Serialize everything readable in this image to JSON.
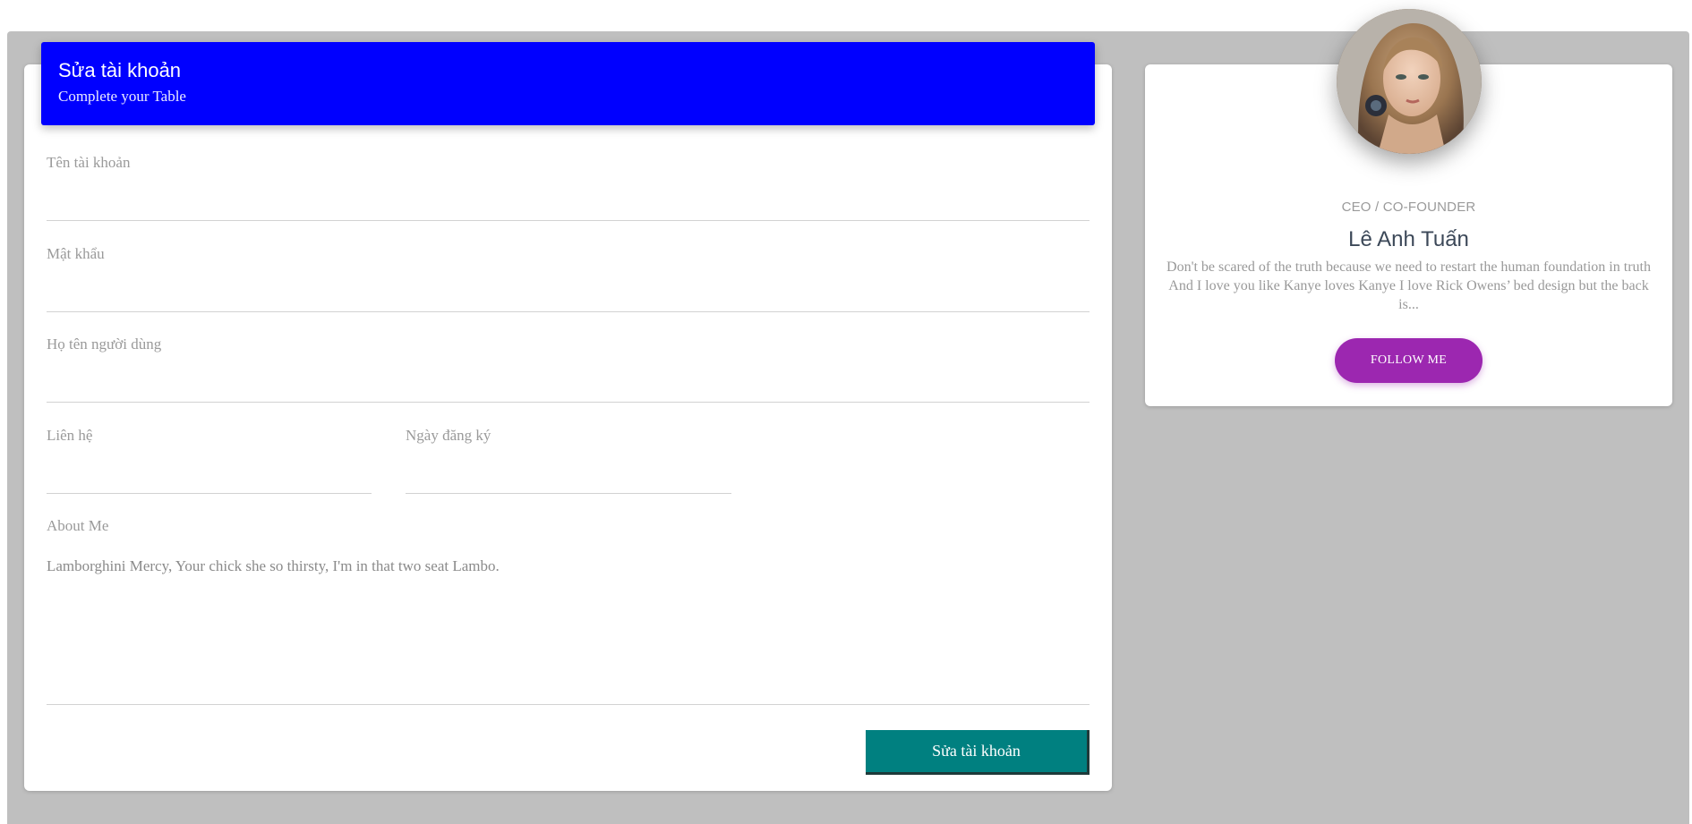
{
  "form": {
    "title": "Sửa tài khoản",
    "subtitle": "Complete your Table",
    "fields": {
      "username": {
        "label": "Tên tài khoản",
        "value": ""
      },
      "password": {
        "label": "Mật khẩu",
        "value": ""
      },
      "fullname": {
        "label": "Họ tên người dùng",
        "value": ""
      },
      "contact": {
        "label": "Liên hệ",
        "value": ""
      },
      "register_date": {
        "label": "Ngày đăng ký",
        "value": ""
      },
      "about": {
        "label": "About Me",
        "value": "Lamborghini Mercy, Your chick she so thirsty, I'm in that two seat Lambo."
      }
    },
    "submit_label": "Sửa tài khoản"
  },
  "profile": {
    "role": "CEO / CO-FOUNDER",
    "name": "Lê Anh Tuấn",
    "bio": "Don't be scared of the truth because we need to restart the human foundation in truth And I love you like Kanye loves Kanye I love Rick Owens’ bed design but the back is...",
    "follow_label": "FOLLOW ME",
    "avatar_icon": "profile-photo"
  },
  "colors": {
    "header_bg": "#0000ff",
    "submit_bg": "#008080",
    "follow_bg": "#9c27b0",
    "backdrop": "#bfbfbf"
  }
}
